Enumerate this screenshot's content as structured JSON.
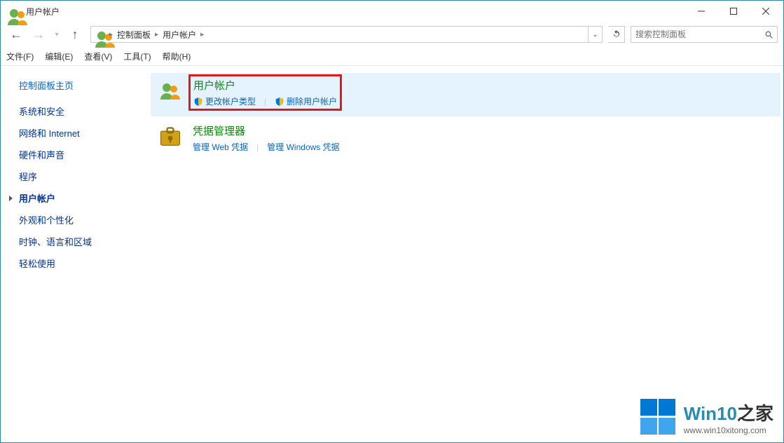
{
  "window": {
    "title": "用户帐户"
  },
  "breadcrumb": {
    "root": "控制面板",
    "current": "用户帐户"
  },
  "search": {
    "placeholder": "搜索控制面板"
  },
  "menu": {
    "file": "文件(F)",
    "edit": "编辑(E)",
    "view": "查看(V)",
    "tools": "工具(T)",
    "help": "帮助(H)"
  },
  "sidebar": {
    "header": "控制面板主页",
    "items": [
      {
        "label": "系统和安全"
      },
      {
        "label": "网络和 Internet"
      },
      {
        "label": "硬件和声音"
      },
      {
        "label": "程序"
      },
      {
        "label": "用户帐户",
        "current": true
      },
      {
        "label": "外观和个性化"
      },
      {
        "label": "时钟、语言和区域"
      },
      {
        "label": "轻松使用"
      }
    ]
  },
  "main": {
    "cat1": {
      "title": "用户帐户",
      "link1": "更改帐户类型",
      "link2": "删除用户帐户"
    },
    "cat2": {
      "title": "凭据管理器",
      "link1": "管理 Web 凭据",
      "link2": "管理 Windows 凭据"
    }
  },
  "watermark": {
    "brand_a": "Win10",
    "brand_b": "之家",
    "url": "www.win10xitong.com"
  }
}
